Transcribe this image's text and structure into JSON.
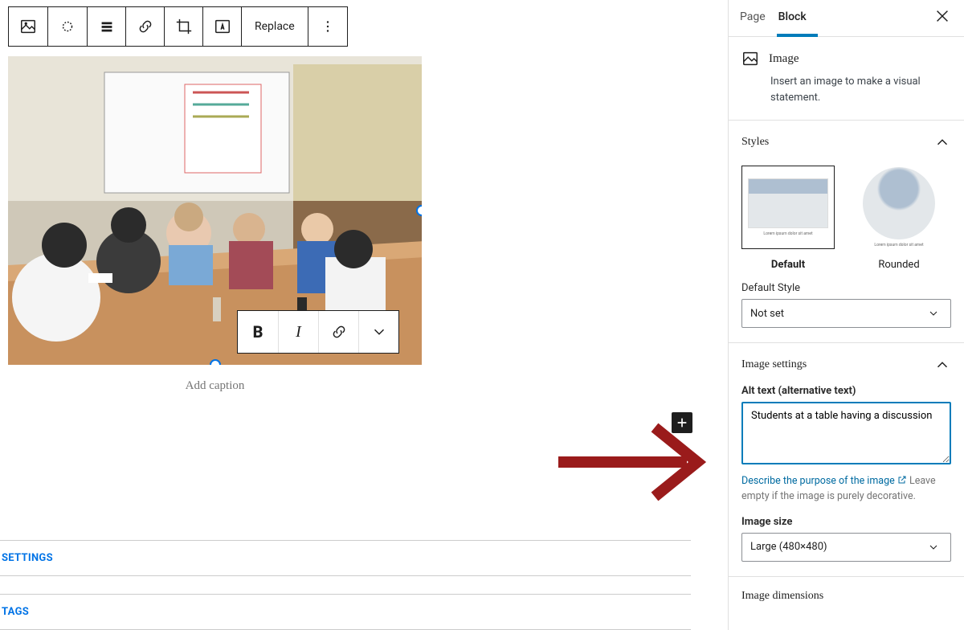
{
  "toolbar": {
    "replace_label": "Replace"
  },
  "image": {
    "caption_placeholder": "Add caption"
  },
  "bottom": {
    "settings": "SETTINGS",
    "tags": "TAGS"
  },
  "sidebar": {
    "tabs": {
      "page": "Page",
      "block": "Block"
    },
    "block_card": {
      "title": "Image",
      "desc": "Insert an image to make a visual statement."
    },
    "styles": {
      "title": "Styles",
      "default": "Default",
      "rounded": "Rounded",
      "default_style_label": "Default Style",
      "default_style_value": "Not set"
    },
    "image_settings": {
      "title": "Image settings",
      "alt_label": "Alt text (alternative text)",
      "alt_value": "Students at a table having a discussion",
      "help_link": "Describe the purpose of the image",
      "help_rest": "Leave empty if the image is purely decorative.",
      "size_label": "Image size",
      "size_value": "Large (480×480)",
      "dimensions_title": "Image dimensions"
    }
  }
}
